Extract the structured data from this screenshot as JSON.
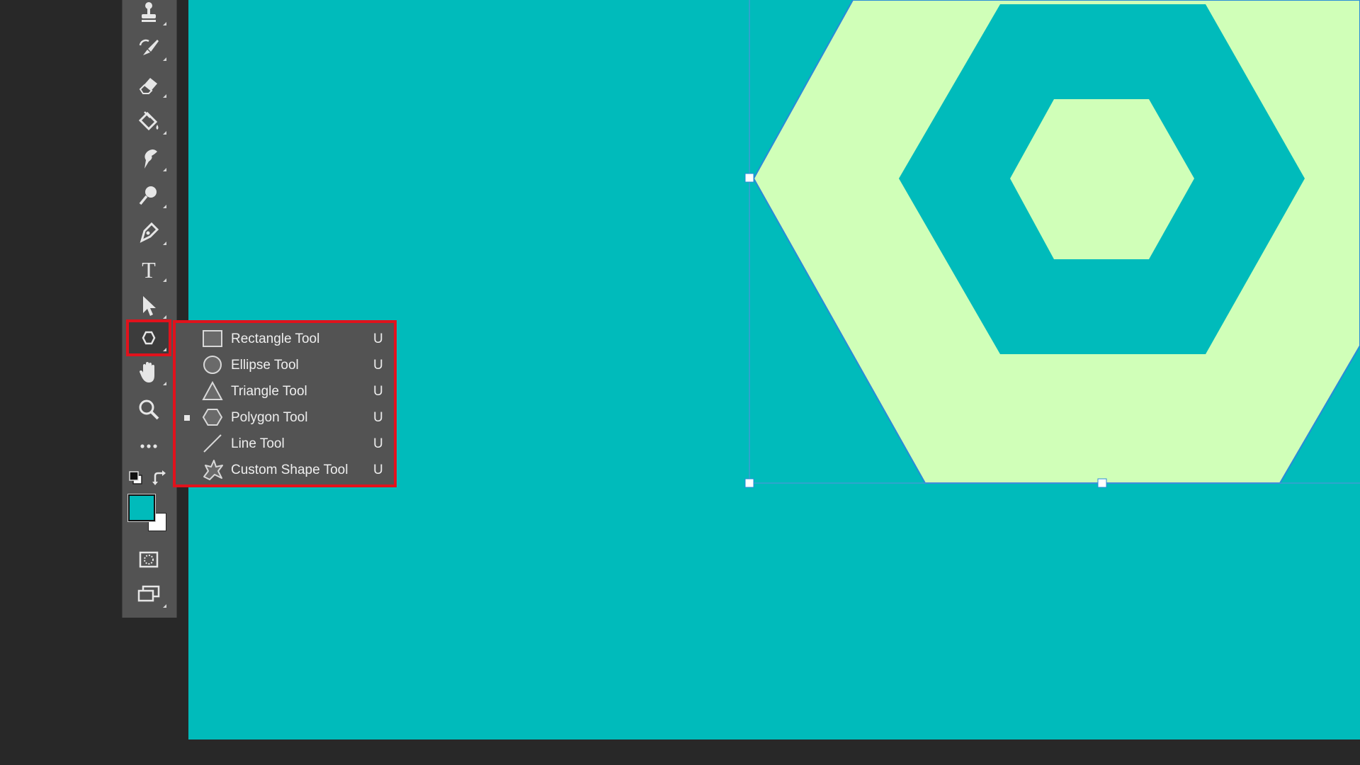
{
  "colors": {
    "canvas": "#00bbbb",
    "shape_fill": "#d0ffb8",
    "highlight": "#e1121c",
    "foreground_swatch": "#00bbbb",
    "background_swatch": "#ffffff"
  },
  "toolbar": {
    "tools": [
      {
        "name": "clone-stamp-icon"
      },
      {
        "name": "history-brush-icon"
      },
      {
        "name": "eraser-icon"
      },
      {
        "name": "paint-bucket-icon"
      },
      {
        "name": "smudge-icon"
      },
      {
        "name": "dodge-icon"
      },
      {
        "name": "pen-icon"
      },
      {
        "name": "type-icon",
        "glyph": "T"
      },
      {
        "name": "path-selection-icon"
      },
      {
        "name": "polygon-icon"
      },
      {
        "name": "hand-icon"
      },
      {
        "name": "zoom-icon"
      },
      {
        "name": "more-icon",
        "glyph": "•••"
      },
      {
        "name": "default-colors-icon"
      },
      {
        "name": "swap-colors-icon"
      },
      {
        "name": "quick-mask-icon"
      },
      {
        "name": "screen-mode-icon"
      }
    ]
  },
  "shape_menu": {
    "items": [
      {
        "label": "Rectangle Tool",
        "shortcut": "U",
        "icon": "rectangle-icon",
        "selected": false
      },
      {
        "label": "Ellipse Tool",
        "shortcut": "U",
        "icon": "ellipse-icon",
        "selected": false
      },
      {
        "label": "Triangle Tool",
        "shortcut": "U",
        "icon": "triangle-icon",
        "selected": false
      },
      {
        "label": "Polygon Tool",
        "shortcut": "U",
        "icon": "polygon-icon",
        "selected": true
      },
      {
        "label": "Line Tool",
        "shortcut": "U",
        "icon": "line-icon",
        "selected": false
      },
      {
        "label": "Custom Shape Tool",
        "shortcut": "U",
        "icon": "custom-shape-icon",
        "selected": false
      }
    ]
  }
}
